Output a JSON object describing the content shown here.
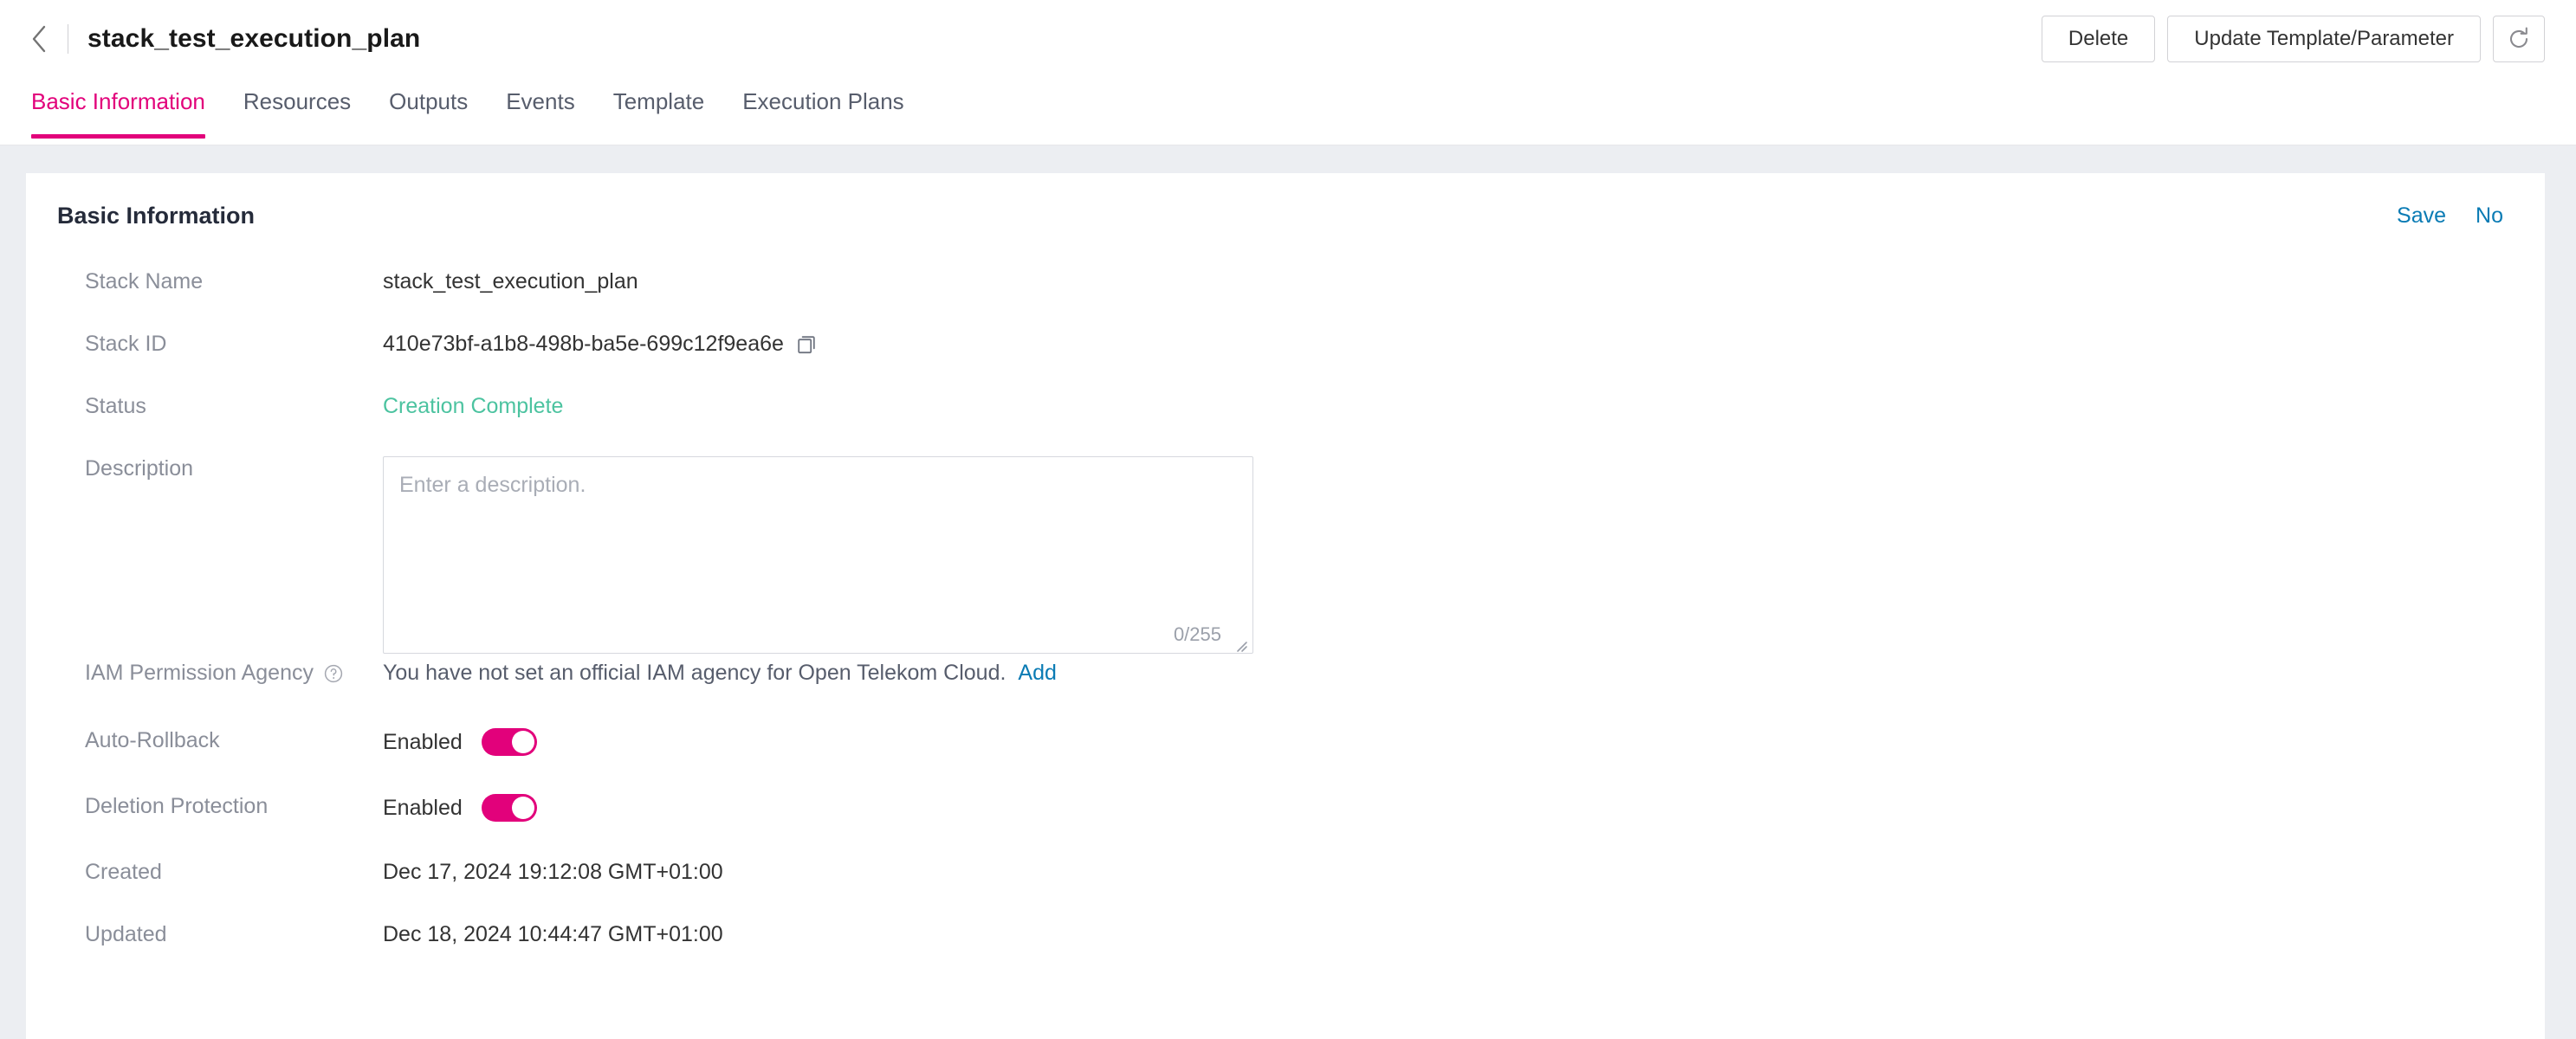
{
  "header": {
    "back_icon": "chevron-left-icon",
    "title": "stack_test_execution_plan",
    "actions": {
      "delete_label": "Delete",
      "update_label": "Update Template/Parameter",
      "refresh_icon": "refresh-icon"
    }
  },
  "tabs": [
    {
      "label": "Basic Information",
      "active": true
    },
    {
      "label": "Resources",
      "active": false
    },
    {
      "label": "Outputs",
      "active": false
    },
    {
      "label": "Events",
      "active": false
    },
    {
      "label": "Template",
      "active": false
    },
    {
      "label": "Execution Plans",
      "active": false
    }
  ],
  "card": {
    "title": "Basic Information",
    "save_label": "Save",
    "cancel_label": "No"
  },
  "fields": {
    "stack_name": {
      "label": "Stack Name",
      "value": "stack_test_execution_plan"
    },
    "stack_id": {
      "label": "Stack ID",
      "value": "410e73bf-a1b8-498b-ba5e-699c12f9ea6e",
      "copy_icon": "copy-icon"
    },
    "status": {
      "label": "Status",
      "value": "Creation Complete"
    },
    "description": {
      "label": "Description",
      "value": "",
      "placeholder": "Enter a description.",
      "counter": "0/255"
    },
    "iam_permission_agency": {
      "label": "IAM Permission Agency",
      "help_icon": "question-circle-icon",
      "text": "You have not set an official IAM agency for Open Telekom Cloud.",
      "link_label": "Add"
    },
    "auto_rollback": {
      "label": "Auto-Rollback",
      "state_text": "Enabled",
      "enabled": true
    },
    "deletion_protection": {
      "label": "Deletion Protection",
      "state_text": "Enabled",
      "enabled": true
    },
    "created": {
      "label": "Created",
      "value": "Dec 17, 2024 19:12:08 GMT+01:00"
    },
    "updated": {
      "label": "Updated",
      "value": "Dec 18, 2024 10:44:47 GMT+01:00"
    }
  },
  "colors": {
    "accent": "#e2017b",
    "link": "#0a7bb4",
    "status_success": "#4cc3a0",
    "page_bg": "#eceef2"
  }
}
